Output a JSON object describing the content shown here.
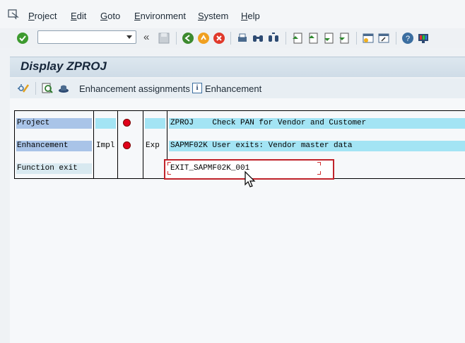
{
  "menu": {
    "items": [
      "Project",
      "Edit",
      "Goto",
      "Environment",
      "System",
      "Help"
    ]
  },
  "toolbar": {
    "command_field_value": "",
    "back_label": "«",
    "icons": [
      "enter-icon",
      "save-icon",
      "back-icon",
      "exit-icon",
      "cancel-icon",
      "print-icon",
      "find-icon",
      "find-next-icon",
      "first-page-icon",
      "previous-page-icon",
      "next-page-icon",
      "last-page-icon",
      "create-session-icon",
      "shortcut-icon",
      "help-icon",
      "customize-layout-icon"
    ]
  },
  "title": "Display ZPROJ",
  "app_toolbar": {
    "enhancement_assignments_label": "Enhancement assignments",
    "enhancement_label": "Enhancement",
    "info_glyph": "i"
  },
  "grid": {
    "rows": [
      {
        "label": "Project",
        "col2": "",
        "status": "red",
        "col4": "",
        "value": "ZPROJ    Check PAN for Vendor and Customer"
      },
      {
        "label": "Enhancement",
        "col2": "Impl",
        "status": "red",
        "col4": "Exp",
        "value": "SAPMF02K User exits: Vendor master data"
      },
      {
        "label": "Function exit",
        "col2": "",
        "status": "",
        "col4": "",
        "value": "EXIT_SAPMF02K_001"
      }
    ]
  },
  "colors": {
    "highlight_border": "#c0232a",
    "row_cyan": "#a3e4f4",
    "label_blue": "#a9c4e8",
    "status_red": "#e0001a"
  }
}
